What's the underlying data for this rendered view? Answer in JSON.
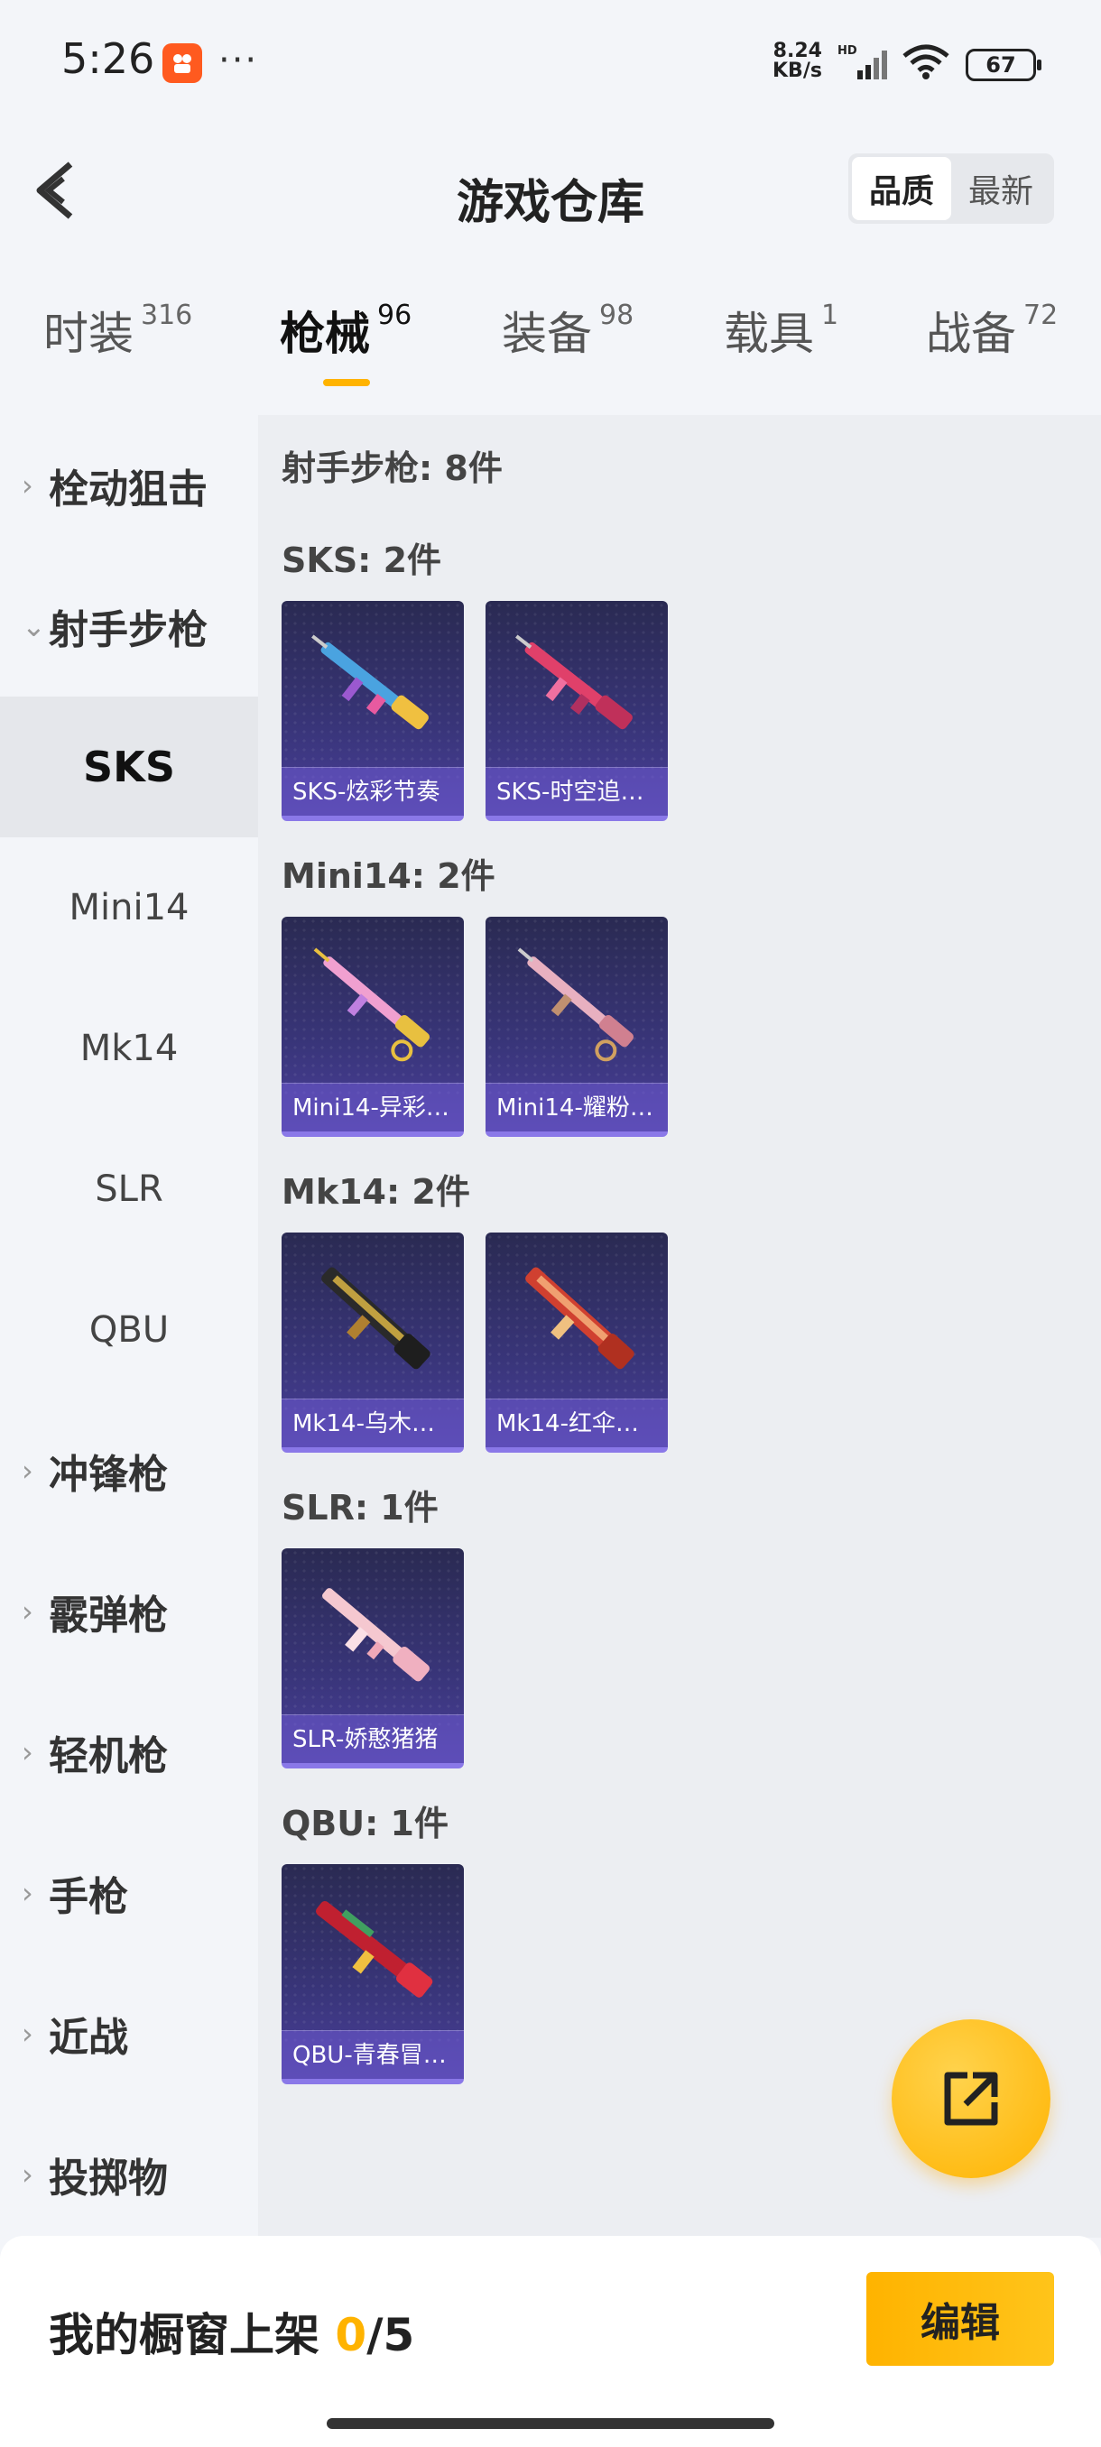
{
  "status_bar": {
    "time": "5:26",
    "net_speed": "8.24",
    "net_unit": "KB/s",
    "net_tag": "HD",
    "battery": "67",
    "more": "···"
  },
  "header": {
    "title": "游戏仓库",
    "sort_options": [
      "品质",
      "最新"
    ]
  },
  "tabs": [
    {
      "label": "时装",
      "count": "316"
    },
    {
      "label": "枪械",
      "count": "96"
    },
    {
      "label": "装备",
      "count": "98"
    },
    {
      "label": "载具",
      "count": "1"
    },
    {
      "label": "战备",
      "count": "72"
    }
  ],
  "sidebar": {
    "groups": [
      {
        "label": "栓动狙击",
        "chevron": "›"
      },
      {
        "label": "射手步枪",
        "chevron": "⌄"
      },
      {
        "label": "冲锋枪",
        "chevron": "›"
      },
      {
        "label": "霰弹枪",
        "chevron": "›"
      },
      {
        "label": "轻机枪",
        "chevron": "›"
      },
      {
        "label": "手枪",
        "chevron": "›"
      },
      {
        "label": "近战",
        "chevron": "›"
      },
      {
        "label": "投掷物",
        "chevron": "›"
      }
    ],
    "subitems": [
      "SKS",
      "Mini14",
      "Mk14",
      "SLR",
      "QBU"
    ]
  },
  "main": {
    "summary": "射手步枪: 8件",
    "groups": [
      {
        "title": "SKS: 2件",
        "items": [
          "SKS-炫彩节奏",
          "SKS-时空追…"
        ]
      },
      {
        "title": "Mini14: 2件",
        "items": [
          "Mini14-异彩…",
          "Mini14-耀粉…"
        ]
      },
      {
        "title": "Mk14: 2件",
        "items": [
          "Mk14-乌木…",
          "Mk14-红伞…"
        ]
      },
      {
        "title": "SLR: 1件",
        "items": [
          "SLR-娇憨猪猪"
        ]
      },
      {
        "title": "QBU: 1件",
        "items": [
          "QBU-青春冒…"
        ]
      }
    ]
  },
  "bottom": {
    "showcase_label": "我的橱窗上架",
    "showcase_current": "0",
    "showcase_total": "/5",
    "edit_label": "编辑"
  }
}
